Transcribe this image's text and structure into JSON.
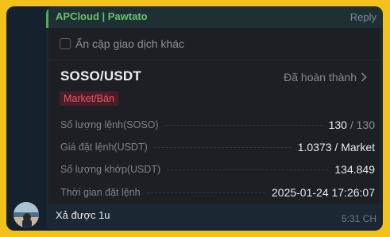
{
  "reply": {
    "author": "APCloud | Pawtato",
    "reply_label": "Reply"
  },
  "card": {
    "hide_other_pairs_label": "Ẩn cặp giao dịch khác",
    "pair": "SOSO/USDT",
    "status": "Đã hoàn thành",
    "order_tag": "Market/Bán",
    "rows": [
      {
        "label": "Số lượng lệnh(SOSO)",
        "value": "130",
        "value_muted": " / 130"
      },
      {
        "label": "Giá đặt lệnh(USDT)",
        "value": "1.0373 / Market",
        "value_muted": ""
      },
      {
        "label": "Số lượng khớp(USDT)",
        "value": "134.849",
        "value_muted": ""
      },
      {
        "label": "Thời gian đặt lệnh",
        "value": "2025-01-24 17:26:07",
        "value_muted": ""
      }
    ]
  },
  "message": {
    "text": "Xả được 1u",
    "time": "5:31 CH"
  },
  "colors": {
    "background": "#f2c21a",
    "bubble": "#1c2734",
    "card": "#1e1f24",
    "reply_name": "#6cc06b",
    "sell_tag_text": "#e45b6a",
    "sell_tag_bg": "#4a1d26"
  }
}
